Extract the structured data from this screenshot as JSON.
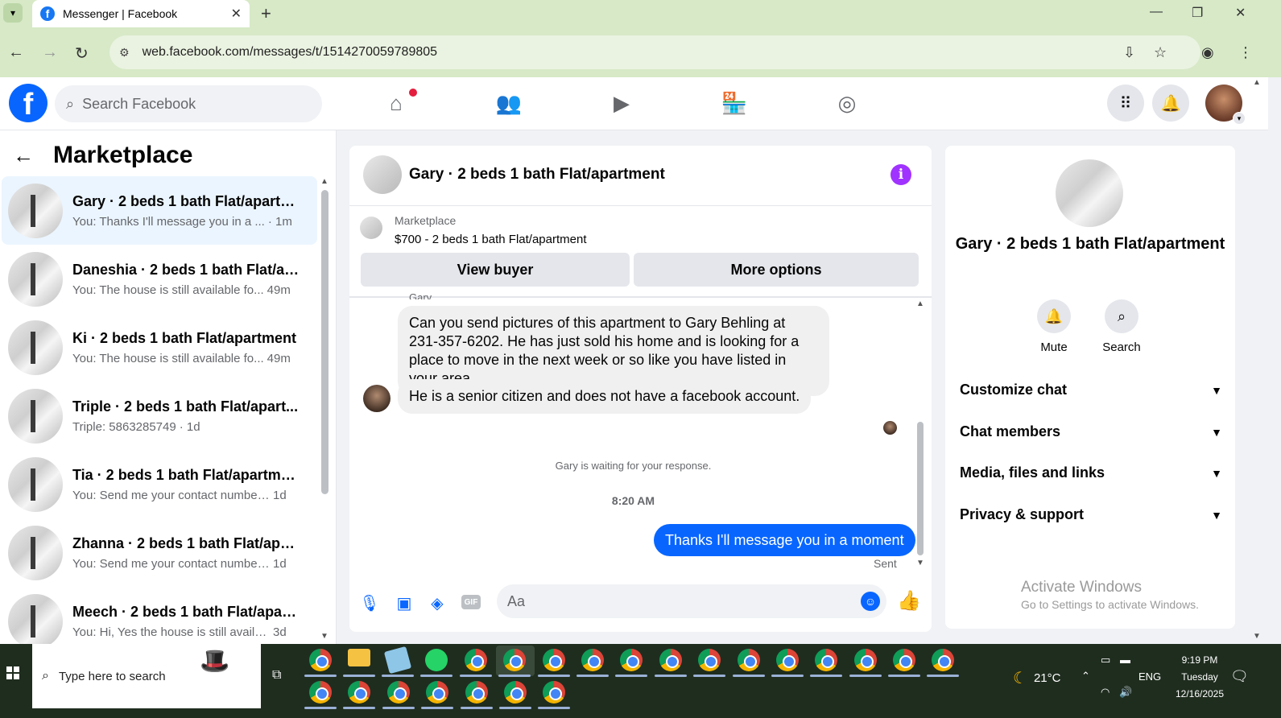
{
  "browser": {
    "tab_title": "Messenger | Facebook",
    "url": "web.facebook.com/messages/t/1514270059789805"
  },
  "fb": {
    "search_placeholder": "Search Facebook",
    "logo_letter": "f"
  },
  "left": {
    "title": "Marketplace",
    "conversations": [
      {
        "name": "Gary · 2 beds 1 bath Flat/apartm...",
        "preview": "You: Thanks I'll message you in a ...",
        "time": "· 1m",
        "active": true
      },
      {
        "name": "Daneshia · 2 beds 1 bath Flat/ap...",
        "preview": "You: The house is still available fo...",
        "time": "49m",
        "active": false
      },
      {
        "name": "Ki · 2 beds 1 bath Flat/apartment",
        "preview": "You: The house is still available fo...",
        "time": "49m",
        "active": false
      },
      {
        "name": "Triple · 2 beds 1 bath Flat/apart...",
        "preview": "Triple: 5863285749",
        "time": "· 1d",
        "active": false
      },
      {
        "name": "Tia · 2 beds 1 bath Flat/apartment",
        "preview": "You: Send me your contact number...",
        "time": "1d",
        "active": false
      },
      {
        "name": "Zhanna · 2 beds 1 bath Flat/apar...",
        "preview": "You: Send me your contact number...",
        "time": "1d",
        "active": false
      },
      {
        "name": "Meech · 2 beds 1 bath Flat/apart...",
        "preview": "You: Hi, Yes the house is still availab...",
        "time": "3d",
        "active": false
      }
    ]
  },
  "chat": {
    "title": "Gary · 2 beds 1 bath Flat/apartment",
    "marketplace_label": "Marketplace",
    "listing": "$700 - 2 beds 1 bath Flat/apartment",
    "view_buyer": "View buyer",
    "more_options": "More options",
    "sender": "Gary",
    "msg1": "Can you send pictures of this apartment to Gary Behling at 231-357-6202. He has just sold his home and is looking for a place to move in the next week or so like you have listed in your area.",
    "msg2": "He is a senior citizen and does not have a facebook account.",
    "waiting": "Gary is waiting for your response.",
    "time": "8:20 AM",
    "my_msg": "Thanks I'll message you in a moment",
    "sent": "Sent",
    "composer_placeholder": "Aa",
    "gif": "GIF"
  },
  "right": {
    "name": "Gary · 2 beds 1 bath Flat/apartment",
    "mute": "Mute",
    "search": "Search",
    "items": [
      "Customize chat",
      "Chat members",
      "Media, files and links",
      "Privacy & support"
    ],
    "activate_title": "Activate Windows",
    "activate_sub": "Go to Settings to activate Windows."
  },
  "taskbar": {
    "search_placeholder": "Type here to search",
    "temp": "21°C",
    "lang": "ENG",
    "clock_time": "9:19 PM",
    "clock_day": "Tuesday",
    "clock_date": "12/16/2025"
  }
}
